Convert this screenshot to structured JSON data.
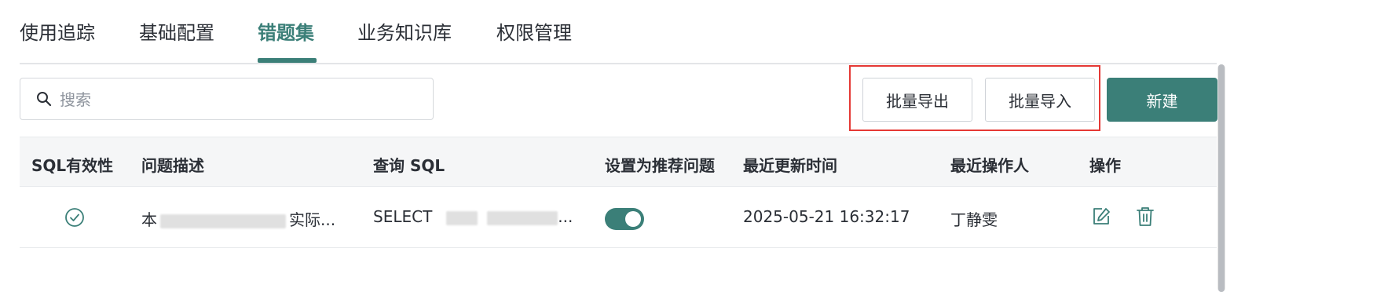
{
  "tabs": [
    {
      "label": "使用追踪"
    },
    {
      "label": "基础配置"
    },
    {
      "label": "错题集"
    },
    {
      "label": "业务知识库"
    },
    {
      "label": "权限管理"
    }
  ],
  "active_tab": "错题集",
  "search": {
    "placeholder": "搜索",
    "value": ""
  },
  "toolbar": {
    "export_label": "批量导出",
    "import_label": "批量导入",
    "new_label": "新建"
  },
  "table": {
    "columns": [
      "SQL有效性",
      "问题描述",
      "查询 SQL",
      "设置为推荐问题",
      "最近更新时间",
      "最近操作人",
      "操作"
    ],
    "rows": [
      {
        "valid": true,
        "question_prefix": "本",
        "question_suffix": "实际...",
        "sql_prefix": "SELECT",
        "sql_suffix": "...",
        "recommended": true,
        "updated_at": "2025-05-21 16:32:17",
        "operator": "丁静雯"
      }
    ]
  },
  "colors": {
    "accent": "#3b7f78",
    "highlight_border": "#e53935"
  },
  "icons": {
    "search": "search-icon",
    "valid": "check-circle-icon",
    "edit": "edit-icon",
    "delete": "trash-icon"
  }
}
